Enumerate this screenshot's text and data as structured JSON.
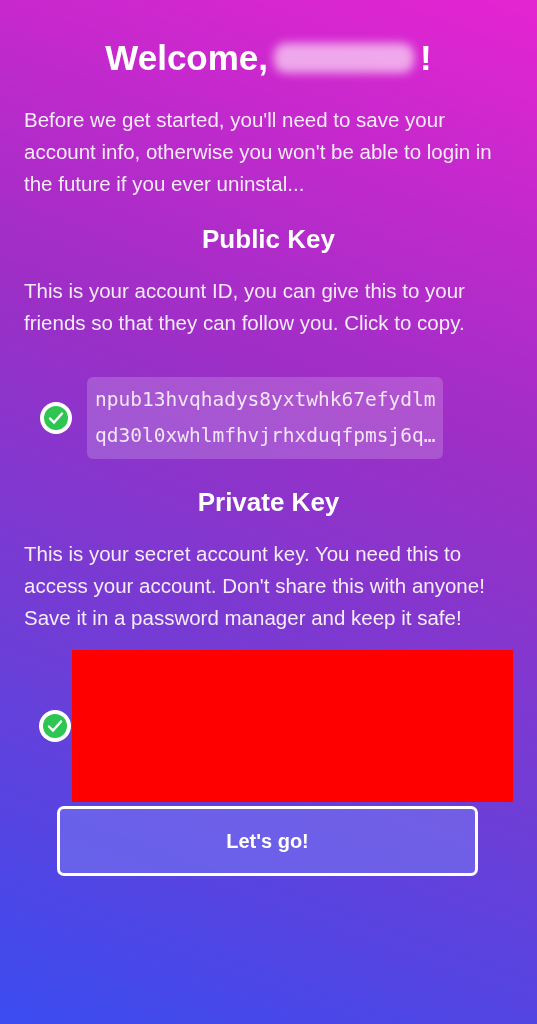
{
  "title": {
    "greeting": "Welcome,",
    "name_redacted": true,
    "exclamation": "!"
  },
  "intro": "Before we get started, you'll need to save your account info, otherwise you won't be able to login in the future if you ever uninstal...",
  "public_key": {
    "heading": "Public Key",
    "description": "This is your account ID, you can give this to your friends so that they can follow you. Click to copy.",
    "value": "npub13hvqhadys8yxtwhk67efydlmqd30l0xwhlmfhvjrhxduqfpmsj6q…"
  },
  "private_key": {
    "heading": "Private Key",
    "description": "This is your secret account key. You need this to access your account. Don't share this with anyone! Save it in a password manager and keep it safe!",
    "redacted": true
  },
  "button": "Let's go!"
}
